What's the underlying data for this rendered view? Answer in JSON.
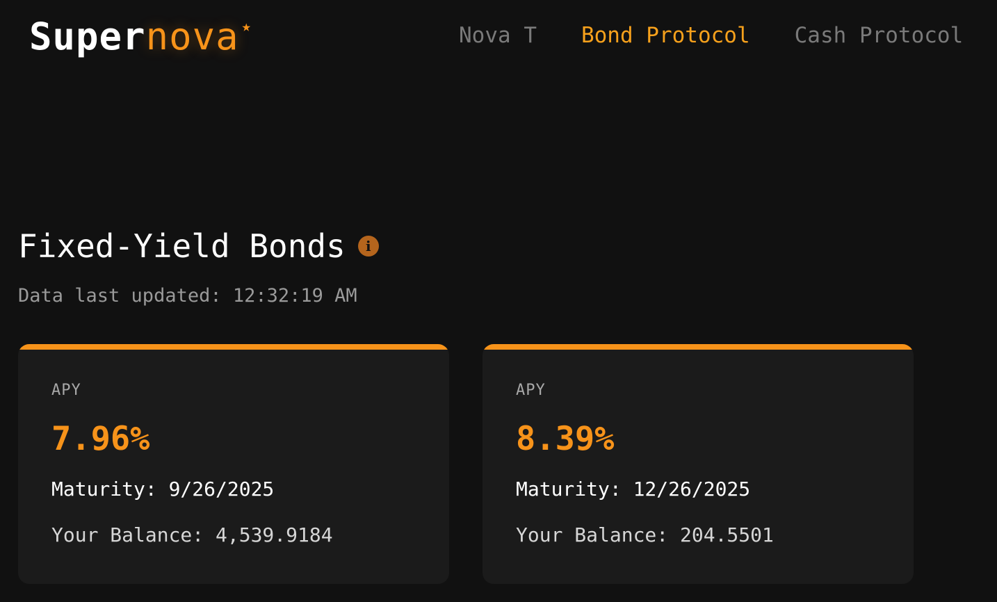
{
  "brand": {
    "name_part1": "Super",
    "name_part2": "nova",
    "star": "★",
    "accent_color": "#f7931a"
  },
  "nav": {
    "items": [
      {
        "label": "Nova T",
        "active": false
      },
      {
        "label": "Bond Protocol",
        "active": true
      },
      {
        "label": "Cash Protocol",
        "active": false
      }
    ]
  },
  "main": {
    "title": "Fixed-Yield Bonds",
    "info_icon": "info-icon",
    "last_updated": "Data last updated: 12:32:19 AM"
  },
  "bonds": [
    {
      "apy_label": "APY",
      "apy_value": "7.96%",
      "maturity": "Maturity: 9/26/2025",
      "balance": "Your Balance: 4,539.9184"
    },
    {
      "apy_label": "APY",
      "apy_value": "8.39%",
      "maturity": "Maturity: 12/26/2025",
      "balance": "Your Balance: 204.5501"
    }
  ]
}
